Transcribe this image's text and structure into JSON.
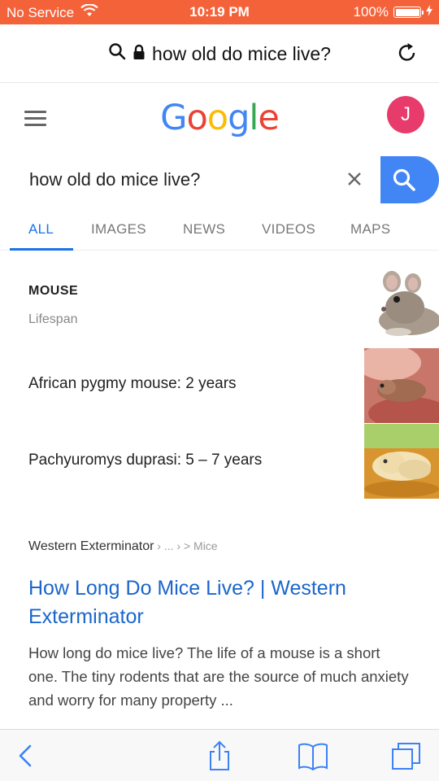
{
  "status_bar": {
    "carrier": "No Service",
    "time": "10:19 PM",
    "battery": "100%",
    "battery_level": 1.0
  },
  "address_bar": {
    "query": "how old do mice live?",
    "icons": [
      "search-icon",
      "lock-icon",
      "reload-icon"
    ]
  },
  "google": {
    "logo_letters": [
      "G",
      "o",
      "o",
      "g",
      "l",
      "e"
    ],
    "logo_colors": [
      "#4285f4",
      "#ea4335",
      "#fbbc05",
      "#4285f4",
      "#34a853",
      "#ea4335"
    ],
    "avatar_letter": "J",
    "avatar_color": "#e73b6b"
  },
  "search": {
    "value": "how old do mice live?",
    "button_color": "#4285f4"
  },
  "tabs": [
    {
      "label": "ALL",
      "active": true
    },
    {
      "label": "IMAGES",
      "active": false
    },
    {
      "label": "NEWS",
      "active": false
    },
    {
      "label": "VIDEOS",
      "active": false
    },
    {
      "label": "MAPS",
      "active": false
    }
  ],
  "knowledge": {
    "title": "MOUSE",
    "subtitle": "Lifespan",
    "items": [
      {
        "text": "African pygmy mouse: 2 years"
      },
      {
        "text": "Pachyuromys duprasi: 5 – 7 years"
      }
    ]
  },
  "result": {
    "site": "Western Exterminator",
    "path": " › ... › > Mice",
    "title": "How Long Do Mice Live? | Western Exterminator",
    "snippet": "How long do mice live? The life of a mouse is a short one. The tiny rodents that are the source of much anxiety and worry for many property ..."
  },
  "toolbar": {
    "icons": [
      "back-icon",
      "share-icon",
      "bookmarks-icon",
      "tabs-icon"
    ]
  },
  "colors": {
    "status_bar": "#f4623a",
    "link": "#1a66cc",
    "active_tab": "#1a73e8"
  }
}
